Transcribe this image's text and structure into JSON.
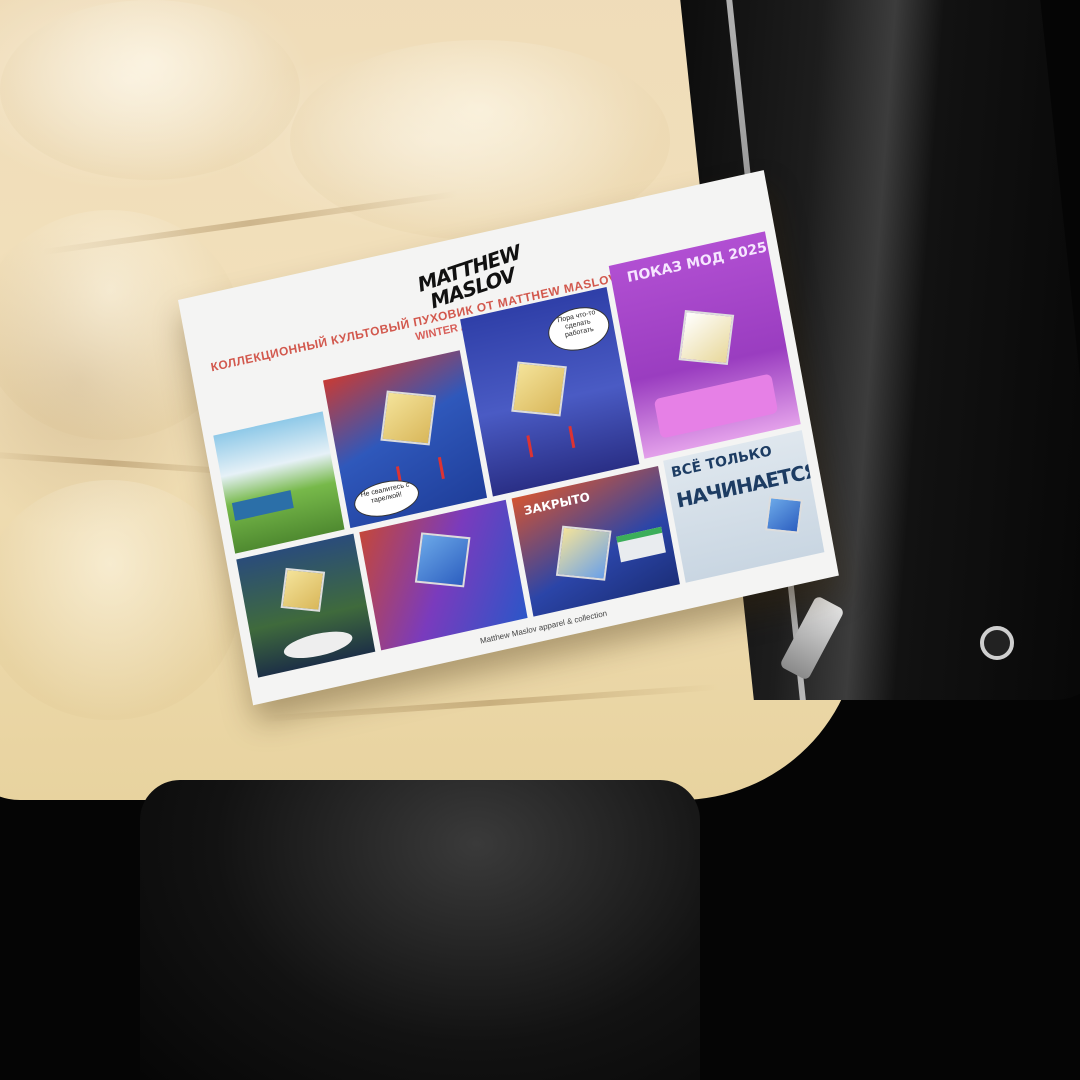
{
  "scene": {
    "background_color": "#050505",
    "jacket_color": "#efdcb9",
    "leather_color": "#111111"
  },
  "card": {
    "logo_line1": "MATTHEW",
    "logo_line2": "MASLOV",
    "headline": "Коллекционный культовый пуховик от Matthew Maslov коллекции",
    "subline": "Winter as Gutter Since",
    "footer": "Matthew Maslov apparel & collection",
    "panels": [
      {
        "id": "mountains",
        "bg": "#6cb0d6"
      },
      {
        "id": "boxing",
        "bg": "#2d57b8",
        "bubble": "Не свалитесь с тарелкой!"
      },
      {
        "id": "bubble-work",
        "bg": "#2f3fa8",
        "bubble": "Пора что-то сделать работать"
      },
      {
        "id": "fashion-show",
        "bg": "#b14fd2",
        "tag": "ПОКАЗ МОД 2025"
      },
      {
        "id": "forest",
        "bg": "#3f6a3c"
      },
      {
        "id": "carnival",
        "bg": "#c4473a"
      },
      {
        "id": "closed",
        "bg": "#d35532",
        "tag": "ЗАКРЫТО"
      },
      {
        "id": "final",
        "bg": "#dfe7ee",
        "tag_line1": "ВСЁ ТОЛЬКО",
        "tag_line2": "НАЧИНАЕТСЯ"
      }
    ]
  }
}
